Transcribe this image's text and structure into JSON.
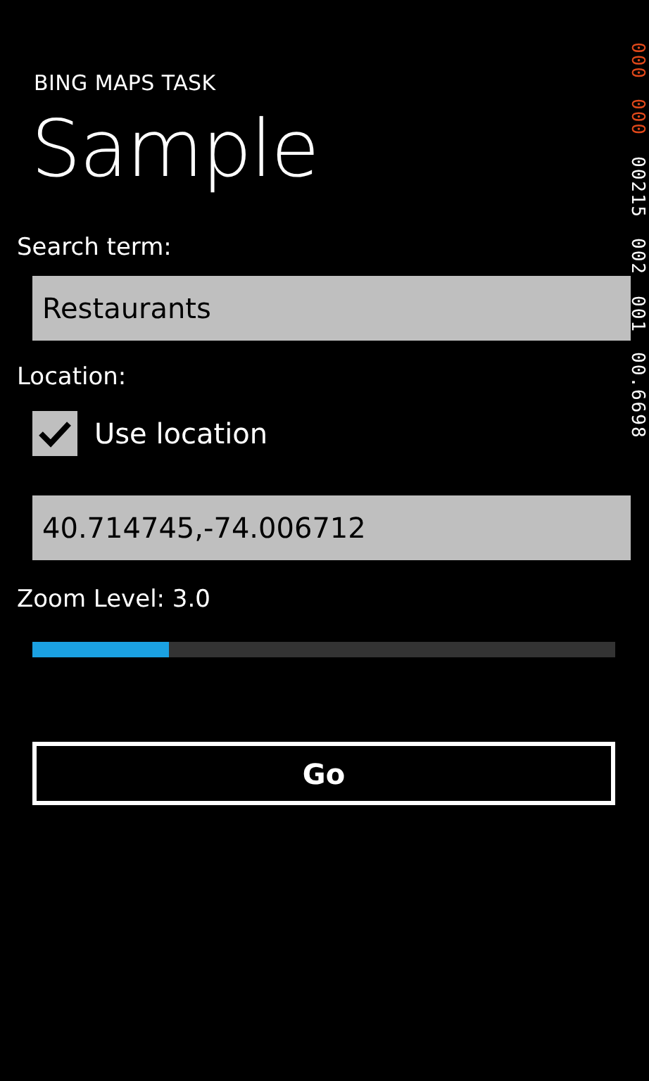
{
  "app_title": "BING MAPS TASK",
  "page_title": "Sample",
  "search": {
    "label": "Search term:",
    "value": "Restaurants"
  },
  "location": {
    "label": "Location:",
    "use_location": {
      "label": "Use location",
      "checked": true
    },
    "value": "40.714745,-74.006712"
  },
  "zoom": {
    "label": "Zoom Level: 3.0",
    "level": 0.235
  },
  "go_button": "Go",
  "frame_counters": [
    {
      "text": "000",
      "color": "#e0481a"
    },
    {
      "text": "000",
      "color": "#e0481a"
    },
    {
      "text": "00215",
      "color": "#ffffff"
    },
    {
      "text": "002",
      "color": "#ffffff"
    },
    {
      "text": "001",
      "color": "#ffffff"
    },
    {
      "text": "00.6698",
      "color": "#ffffff"
    }
  ]
}
